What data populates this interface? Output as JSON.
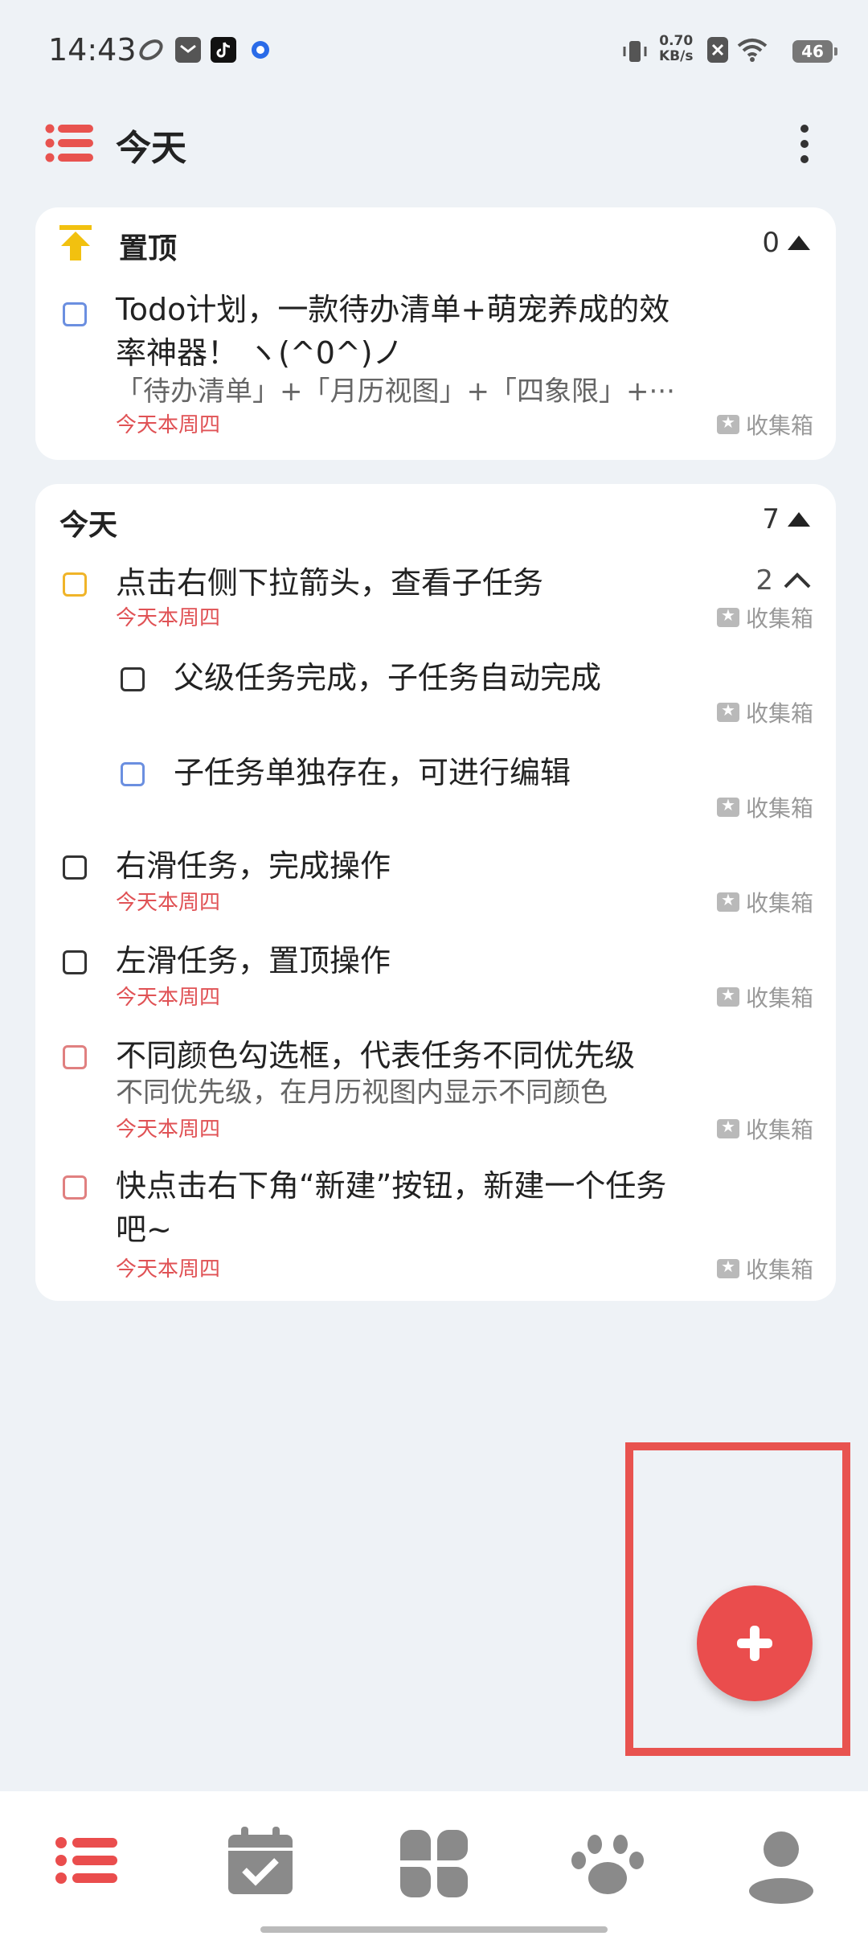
{
  "status_bar": {
    "time": "14:43",
    "net_speed_value": "0.70",
    "net_speed_unit": "KB/s",
    "battery": "46",
    "icons": [
      "app-icon-1",
      "mail-icon",
      "tiktok-icon",
      "browser-icon",
      "vibrate-icon",
      "sim-x-icon",
      "wifi-icon"
    ]
  },
  "app_bar": {
    "title": "今天",
    "menu_icon": "list-icon",
    "more_icon": "more-vert-icon"
  },
  "pinned_card": {
    "title": "置顶",
    "count": "0",
    "tasks": [
      {
        "title_line1": "Todo计划，一款待办清单+萌宠养成的效",
        "title_line2": "率神器！ ヽ(^0^)ノ",
        "note": "「待办清单」+「月历视图」+「四象限」+···",
        "date": "今天本周四",
        "list": "收集箱",
        "checkbox_color": "#6b8fe0"
      }
    ]
  },
  "today_card": {
    "title": "今天",
    "count": "7",
    "tasks": [
      {
        "title": "点击右侧下拉箭头，查看子任务",
        "date": "今天本周四",
        "list": "收集箱",
        "subtask_count": "2",
        "checkbox_color": "#f0b429"
      },
      {
        "title": "父级任务完成，子任务自动完成",
        "list": "收集箱",
        "checkbox_color": "#333333"
      },
      {
        "title": "子任务单独存在，可进行编辑",
        "list": "收集箱",
        "checkbox_color": "#6b8fe0"
      },
      {
        "title": "右滑任务，完成操作",
        "date": "今天本周四",
        "list": "收集箱",
        "checkbox_color": "#333333"
      },
      {
        "title": "左滑任务，置顶操作",
        "date": "今天本周四",
        "list": "收集箱",
        "checkbox_color": "#333333"
      },
      {
        "title": "不同颜色勾选框，代表任务不同优先级",
        "note": "不同优先级，在月历视图内显示不同颜色",
        "date": "今天本周四",
        "list": "收集箱",
        "checkbox_color": "#e08080"
      },
      {
        "title_line1": "快点击右下角“新建”按钮，新建一个任务",
        "title_line2": "吧~",
        "date": "今天本周四",
        "list": "收集箱",
        "checkbox_color": "#e08080"
      }
    ]
  },
  "fab": {
    "icon": "plus-icon",
    "color": "#ea4d4d"
  },
  "bottom_nav": {
    "items": [
      "tasks-list-icon",
      "calendar-check-icon",
      "four-quadrant-icon",
      "paw-icon",
      "profile-icon"
    ],
    "active_color": "#ea4d4d",
    "inactive_color": "#8a8a8a"
  }
}
